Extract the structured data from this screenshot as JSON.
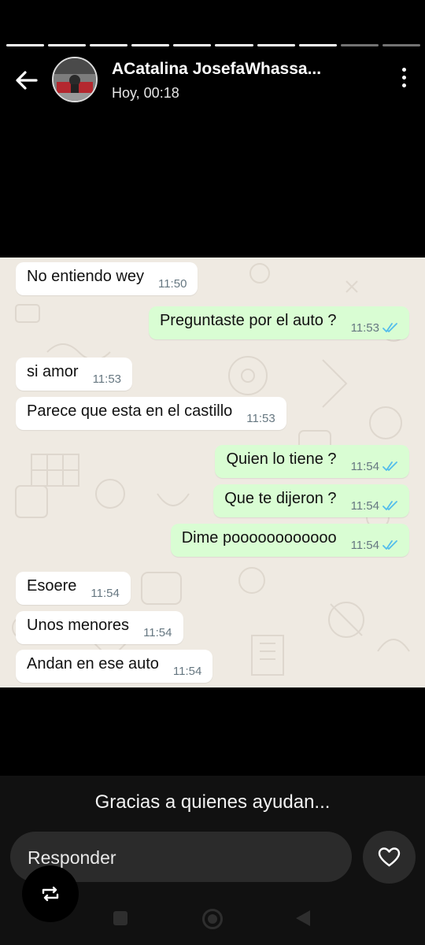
{
  "story": {
    "segments_total": 10,
    "segments_viewed": 8
  },
  "header": {
    "contact_name": "ACatalina JosefaWhassa...",
    "timestamp": "Hoy, 00:18",
    "back_icon": "arrow-left-icon",
    "menu_icon": "more-vertical-icon"
  },
  "chat": {
    "messages": [
      {
        "dir": "in",
        "text": "No entiendo wey",
        "time": "11:50"
      },
      {
        "dir": "out",
        "text": "Preguntaste por el auto ?",
        "time": "11:53",
        "read": true
      },
      {
        "dir": "in",
        "text": "si amor",
        "time": "11:53"
      },
      {
        "dir": "in",
        "text": "Parece que esta en el castillo",
        "time": "11:53"
      },
      {
        "dir": "out",
        "text": "Quien lo tiene ?",
        "time": "11:54",
        "read": true
      },
      {
        "dir": "out",
        "text": "Que te dijeron ?",
        "time": "11:54",
        "read": true
      },
      {
        "dir": "out",
        "text": "Dime poooooooooooo",
        "time": "11:54",
        "read": true
      },
      {
        "dir": "in",
        "text": "Esoere",
        "time": "11:54"
      },
      {
        "dir": "in",
        "text": "Unos menores",
        "time": "11:54"
      },
      {
        "dir": "in",
        "text": "Andan en ese auto",
        "time": "11:54"
      }
    ],
    "colors": {
      "background": "#efeae2",
      "incoming": "#ffffff",
      "outgoing": "#d9fdd3",
      "read_ticks": "#53bdeb"
    }
  },
  "bottom": {
    "caption": "Gracias a quienes ayudan...",
    "reply_placeholder": "Responder",
    "heart_icon": "heart-icon",
    "repost_icon": "repost-icon"
  },
  "navigation": {
    "recents_icon": "square-icon",
    "home_icon": "circle-icon",
    "back_icon": "triangle-back-icon"
  }
}
